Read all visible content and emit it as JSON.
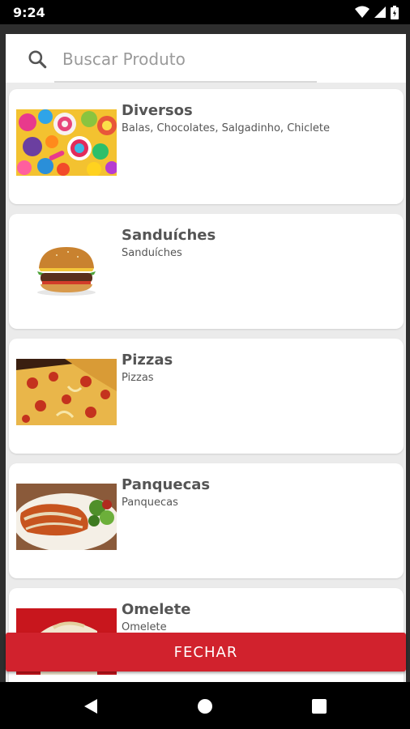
{
  "status_bar": {
    "time": "9:24",
    "icons": [
      "wifi-icon",
      "signal-icon",
      "battery-icon"
    ]
  },
  "search": {
    "placeholder": "Buscar Produto",
    "icon": "search-icon"
  },
  "categories": [
    {
      "title": "Diversos",
      "subtitle": "Balas, Chocolates, Salgadinho, Chiclete",
      "image": "candy-image"
    },
    {
      "title": "Sanduíches",
      "subtitle": "Sanduíches",
      "image": "burger-image"
    },
    {
      "title": "Pizzas",
      "subtitle": "Pizzas",
      "image": "pizza-image"
    },
    {
      "title": "Panquecas",
      "subtitle": "Panquecas",
      "image": "pancake-image"
    },
    {
      "title": "Omelete",
      "subtitle": "Omelete",
      "image": "omelette-image"
    }
  ],
  "close_button": {
    "label": "FECHAR",
    "color": "#d1222d"
  },
  "nav": {
    "buttons": [
      "back-icon",
      "home-icon",
      "recents-icon"
    ]
  }
}
